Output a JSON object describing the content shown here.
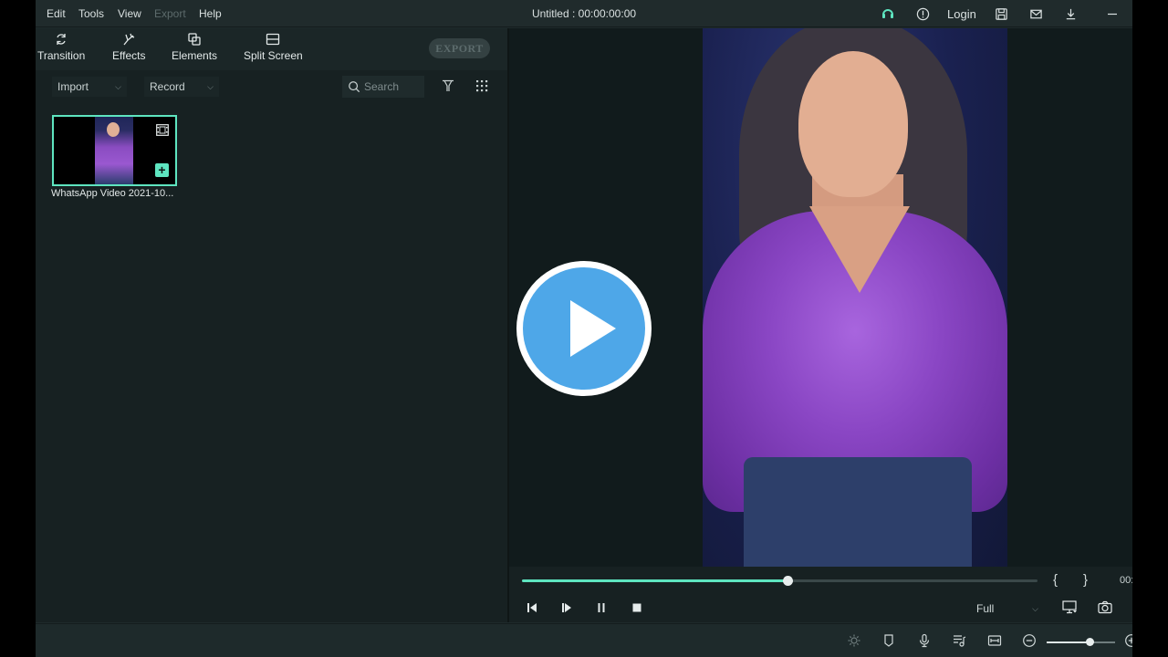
{
  "menu": {
    "items": [
      {
        "label": "Edit",
        "enabled": true
      },
      {
        "label": "Tools",
        "enabled": true
      },
      {
        "label": "View",
        "enabled": true
      },
      {
        "label": "Export",
        "enabled": false
      },
      {
        "label": "Help",
        "enabled": true
      }
    ],
    "title": "Untitled : 00:00:00:00",
    "login_label": "Login"
  },
  "toolbar": {
    "transition_label": "Transition",
    "effects_label": "Effects",
    "elements_label": "Elements",
    "split_screen_label": "Split Screen",
    "export_label": "EXPORT"
  },
  "media": {
    "import_label": "Import",
    "record_label": "Record",
    "search_placeholder": "Search",
    "items": [
      {
        "name": "WhatsApp Video 2021-10..."
      }
    ]
  },
  "player": {
    "progress": 0.515,
    "open_bracket": "{",
    "close_bracket": "}",
    "timecode": "00:",
    "quality": "Full"
  },
  "timeline": {
    "zoom_level": 0.62
  },
  "colors": {
    "accent": "#5ee5c0",
    "play_overlay": "#4ea7e8"
  }
}
